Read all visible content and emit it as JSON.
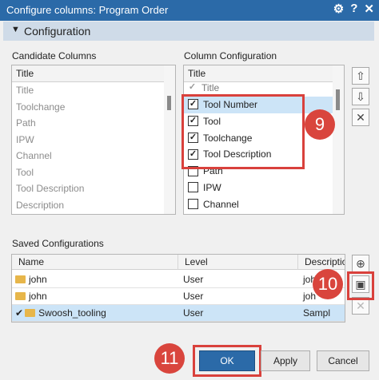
{
  "window": {
    "title": "Configure columns: Program Order"
  },
  "section": {
    "label": "Configuration"
  },
  "candidate": {
    "label": "Candidate Columns",
    "header": "Title",
    "items": [
      "Title",
      "Toolchange",
      "Path",
      "IPW",
      "Channel",
      "Tool",
      "Tool Description",
      "Description"
    ]
  },
  "column_config": {
    "label": "Column Configuration",
    "header": "Title",
    "items": [
      {
        "label": "Title",
        "checked": true,
        "partial": true
      },
      {
        "label": "Tool Number",
        "checked": true
      },
      {
        "label": "Tool",
        "checked": true
      },
      {
        "label": "Toolchange",
        "checked": true
      },
      {
        "label": "Tool Description",
        "checked": true
      },
      {
        "label": "Path",
        "checked": false
      },
      {
        "label": "IPW",
        "checked": false
      },
      {
        "label": "Channel",
        "checked": false
      }
    ]
  },
  "saved": {
    "label": "Saved Configurations",
    "headers": [
      "Name",
      "Level",
      "Descriptio"
    ],
    "rows": [
      {
        "name": "john",
        "level": "User",
        "desc": "joh"
      },
      {
        "name": "john",
        "level": "User",
        "desc": "joh"
      },
      {
        "name": "Swoosh_tooling",
        "level": "User",
        "desc": "Sampl",
        "active": true
      }
    ]
  },
  "badges": [
    "9",
    "10",
    "11"
  ],
  "buttons": {
    "ok": "OK",
    "apply": "Apply",
    "cancel": "Cancel"
  },
  "colors": {
    "titlebar": "#2b6aa8",
    "accent": "#d9413c",
    "selection": "#cce4f7"
  }
}
